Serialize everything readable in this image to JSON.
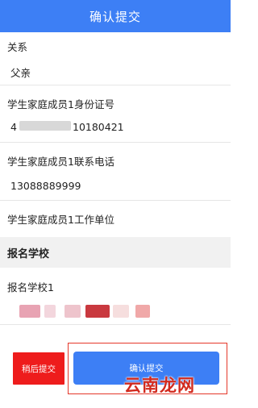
{
  "header": {
    "title": "确认提交"
  },
  "fields": [
    {
      "label": "关系",
      "value": "父亲"
    },
    {
      "label": "学生家庭成员1身份证号",
      "value_prefix": "4",
      "value_suffix": "10180421"
    },
    {
      "label": "学生家庭成员1联系电话",
      "value": "13088889999"
    },
    {
      "label": "学生家庭成员1工作单位",
      "value": ""
    }
  ],
  "section": {
    "title": "报名学校"
  },
  "school": {
    "label": "报名学校1"
  },
  "buttons": {
    "later": "稍后提交",
    "confirm": "确认提交"
  },
  "watermark": {
    "text": "云南龙网"
  },
  "colors": {
    "primary": "#3d7ff5",
    "danger": "#ee1c1c",
    "highlight": "#e5382a"
  }
}
